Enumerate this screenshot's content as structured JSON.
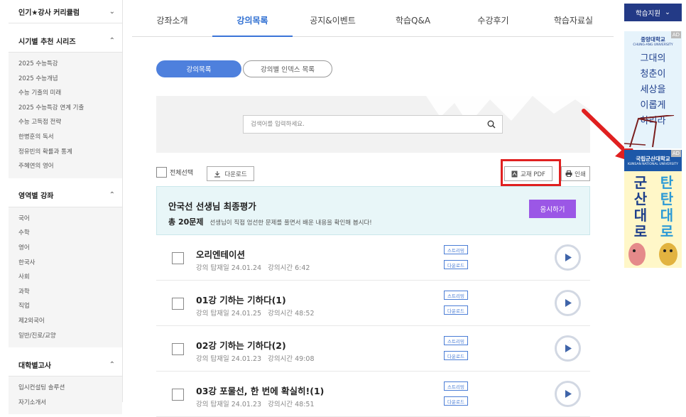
{
  "sidebar": {
    "top_item": "인기★강사 커리큘럼",
    "sections": [
      {
        "title": "시기별 추천 시리즈",
        "items": [
          "2025 수능특강",
          "2025 수능개념",
          "수능 기출의 미래",
          "2025 수능특강 연계 기출",
          "수능 고득점 전략",
          "한병훈의 독서",
          "정유빈의 확률과 통계",
          "주혜연의 영어"
        ]
      },
      {
        "title": "영역별 강좌",
        "items": [
          "국어",
          "수학",
          "영어",
          "한국사",
          "사회",
          "과학",
          "직업",
          "제2외국어",
          "일반/진로/교양"
        ]
      },
      {
        "title": "대학별고사",
        "items": [
          "입시컨설팅 솔루션",
          "자기소개서"
        ]
      }
    ]
  },
  "tabs": [
    "강좌소개",
    "강의목록",
    "공지&이벤트",
    "학습Q&A",
    "수강후기",
    "학습자료실"
  ],
  "pills": {
    "list": "강의목록",
    "index": "강의별 인덱스 목록"
  },
  "search": {
    "placeholder": "검색어를 입력하세요."
  },
  "toolbar": {
    "select_all": "전체선택",
    "download": "다운로드",
    "pdf": "교재 PDF",
    "print": "인쇄"
  },
  "exam": {
    "title": "안국선 선생님 최종평가",
    "count": "총 20문제",
    "desc": "선생님이 직접 엄선한 문제를 풀면서 배운 내용을 확인해 봅시다!",
    "button": "응시하기"
  },
  "lectures": [
    {
      "title": "오리엔테이션",
      "date_label": "강의 탑재일",
      "date": "24.01.24",
      "time_label": "강의시간",
      "time": "6:42"
    },
    {
      "title": "01강 기하는 기하다(1)",
      "date_label": "강의 탑재일",
      "date": "24.01.25",
      "time_label": "강의시간",
      "time": "48:52"
    },
    {
      "title": "02강 기하는 기하다(2)",
      "date_label": "강의 탑재일",
      "date": "24.01.23",
      "time_label": "강의시간",
      "time": "49:08"
    },
    {
      "title": "03강 포물선, 한 번에 확실히!(1)",
      "date_label": "강의 탑재일",
      "date": "24.01.23",
      "time_label": "강의시간",
      "time": "48:51"
    }
  ],
  "tags": {
    "stream": "스트리밍",
    "download": "다운로드"
  },
  "right": {
    "support": "학습지원",
    "ad_label": "AD",
    "ad1_logo": "중앙대학교",
    "ad1_logo_en": "CHUNG-ANG UNIVERSITY",
    "ad1_lines": [
      "그대의",
      "청춘이",
      "세상을",
      "이롭게",
      "하리라"
    ],
    "ad2_logo": "국립군산대학교",
    "ad2_logo_en": "KUNSAN NATIONAL UNIVERSITY",
    "ad2_col1": [
      "군",
      "산",
      "대",
      "로"
    ],
    "ad2_col2": [
      "탄",
      "탄",
      "대",
      "로"
    ]
  },
  "colors": {
    "accent": "#3b74d8",
    "exam_button": "#9b57e6",
    "highlight": "#e02020"
  }
}
